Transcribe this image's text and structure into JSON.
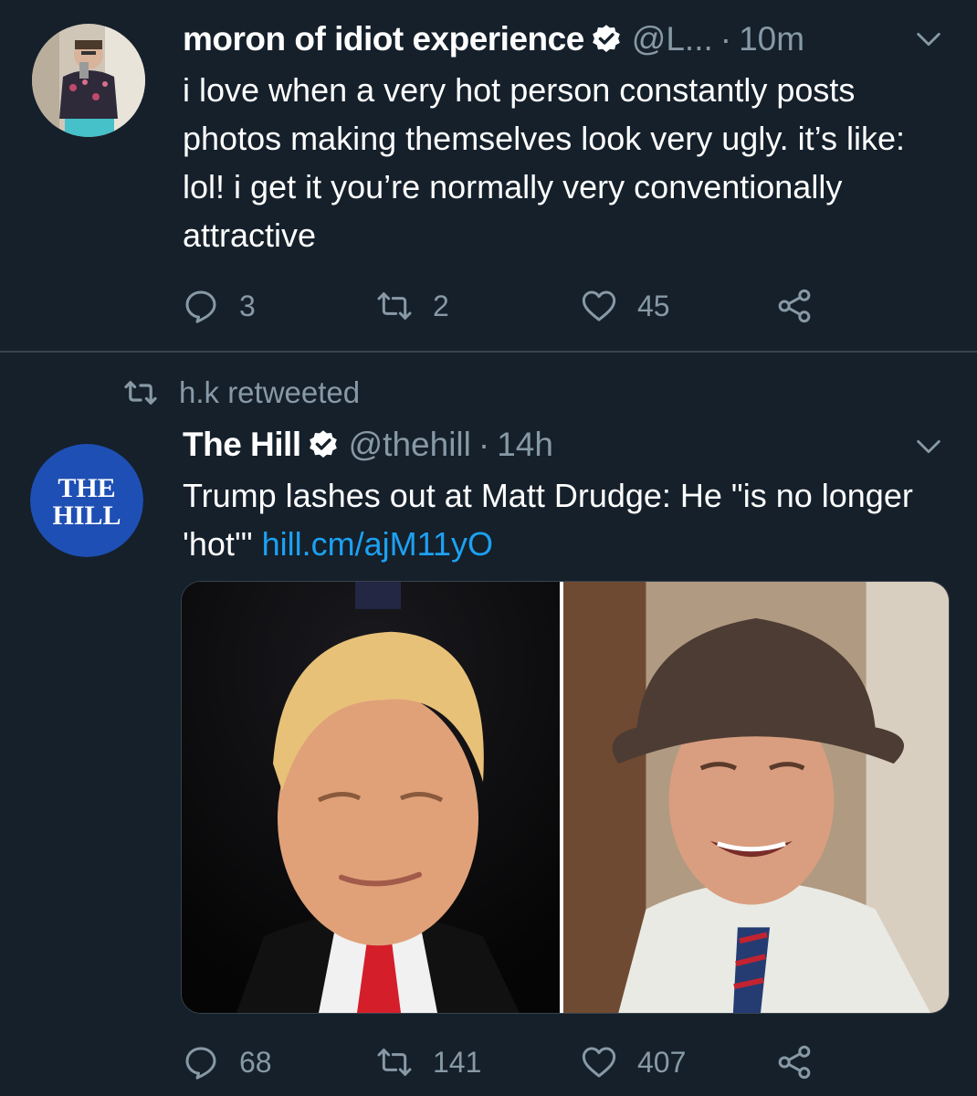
{
  "tweet1": {
    "name": "moron of idiot experience",
    "handle": "@L...",
    "separator": "·",
    "time": "10m",
    "text": "i love when a very hot person constantly posts photos making themselves look very ugly. it’s like: lol! i get it you’re normally very conventionally attractive",
    "replies": "3",
    "retweets": "2",
    "likes": "45"
  },
  "tweet2": {
    "retweeted_by": "h.k retweeted",
    "avatar_text_line1": "THE",
    "avatar_text_line2": "HILL",
    "name": "The Hill",
    "handle": "@thehill",
    "separator": "·",
    "time": "14h",
    "text": "Trump lashes out at Matt Drudge: He \"is no longer 'hot'\" ",
    "link": "hill.cm/ajM11yO",
    "replies": "68",
    "retweets": "141",
    "likes": "407"
  },
  "colors": {
    "background": "#15202b",
    "divider": "#38444d",
    "secondary_text": "#8899a6",
    "link": "#1da1f2",
    "hill_blue": "#1e4fb4"
  },
  "icons": [
    "verified-icon",
    "chevron-down-icon",
    "reply-icon",
    "retweet-icon",
    "like-icon",
    "share-icon"
  ]
}
